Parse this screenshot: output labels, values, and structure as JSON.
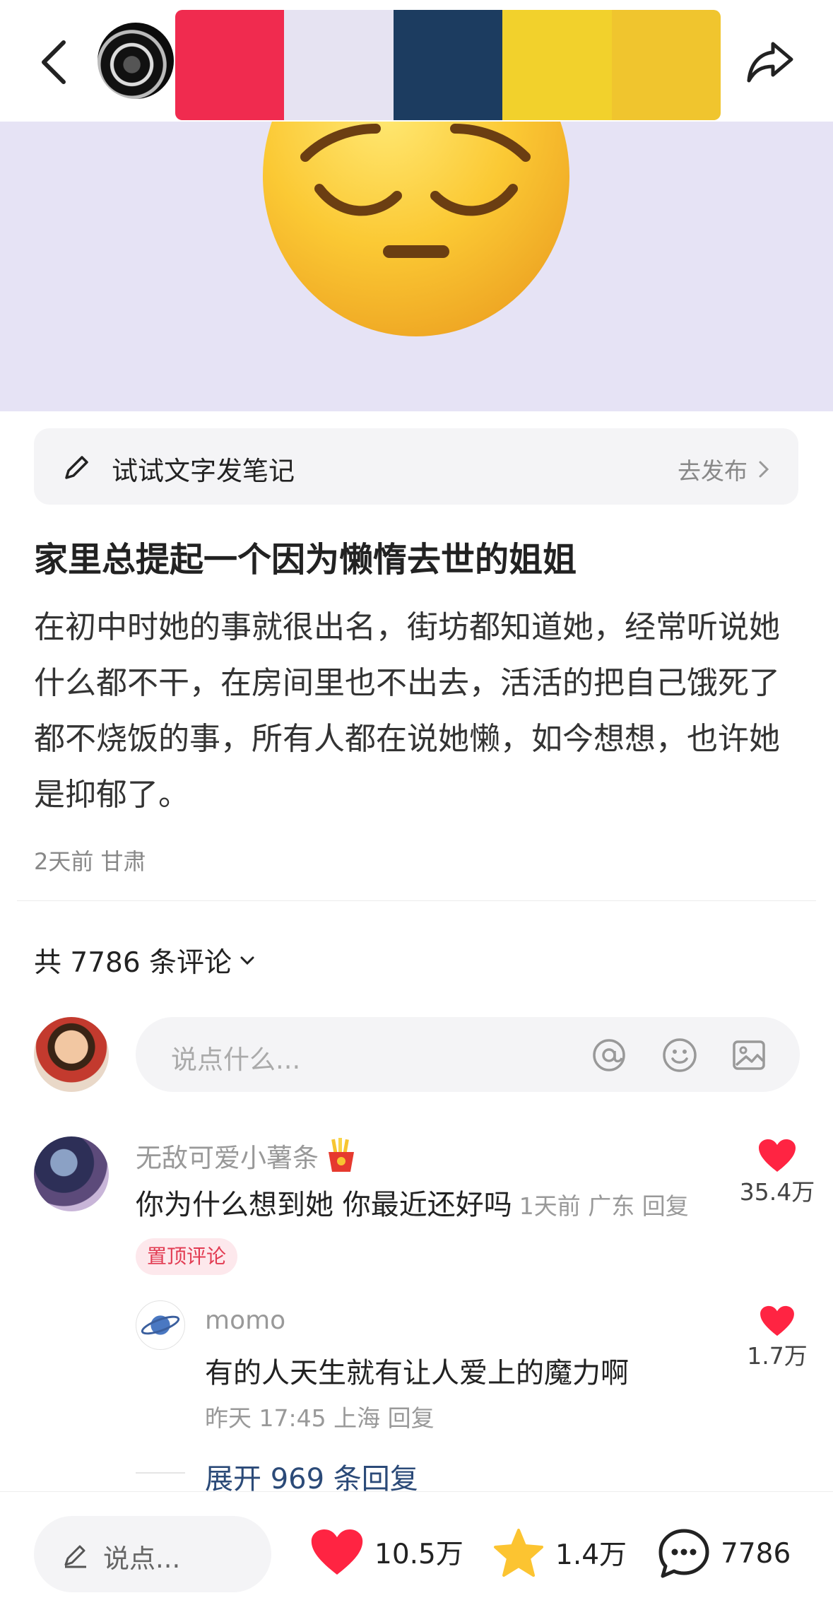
{
  "header": {
    "swatch_colors": [
      "#f02b4f",
      "#e6e3f2",
      "#1c3c60",
      "#f2d12c",
      "#f0c52e"
    ]
  },
  "hero": {
    "background": "#e6e3f5",
    "emoji": "pensive-face-icon"
  },
  "try_text": {
    "label": "试试文字发笔记",
    "action": "去发布"
  },
  "post": {
    "title": "家里总提起一个因为懒惰去世的姐姐",
    "body": "在初中时她的事就很出名，街坊都知道她，经常听说她什么都不干，在房间里也不出去，活活的把自己饿死了都不烧饭的事，所有人都在说她懒，如今想想，也许她是抑郁了。",
    "meta": "2天前 甘肃"
  },
  "comments": {
    "count_label": "共 7786 条评论",
    "input_placeholder": "说点什么...",
    "items": [
      {
        "name": "无敌可爱小薯条",
        "name_icon": "fries-icon",
        "text": "你为什么想到她 你最近还好吗",
        "meta": "1天前 广东 回复",
        "badge": "置顶评论",
        "likes": "35.4万",
        "replies": [
          {
            "name": "momo",
            "text": "有的人天生就有让人爱上的魔力啊",
            "meta": "昨天 17:45 上海 回复",
            "likes": "1.7万"
          }
        ],
        "expand_label": "展开 969 条回复"
      }
    ]
  },
  "bottom_bar": {
    "input_placeholder": "说点...",
    "likes": "10.5万",
    "favorites": "1.4万",
    "comments": "7786"
  },
  "colors": {
    "heart": "#ff2442",
    "star": "#fcc431",
    "link": "#2b4a78"
  }
}
